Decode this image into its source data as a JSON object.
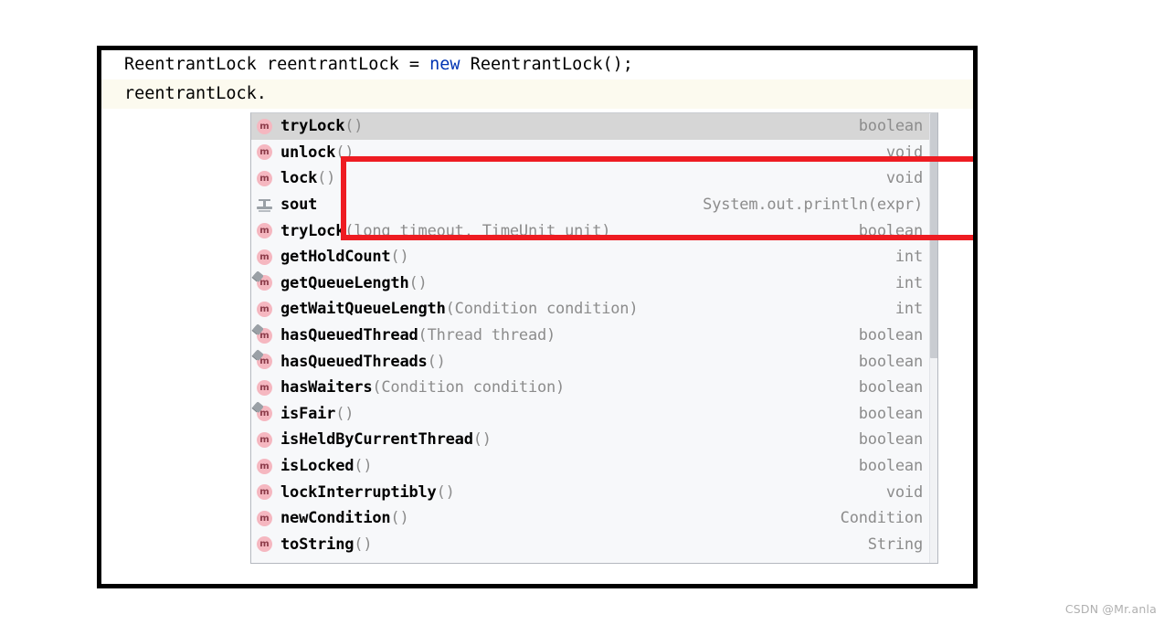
{
  "editor": {
    "lines": [
      {
        "id": "line-1",
        "segments": [
          {
            "text": "ReentrantLock reentrantLock = ",
            "kind": "plain"
          },
          {
            "text": "new",
            "kind": "keyword"
          },
          {
            "text": " ReentrantLock();",
            "kind": "plain"
          }
        ],
        "highlighted": false
      },
      {
        "id": "line-2",
        "segments": [
          {
            "text": "reentrantLock.",
            "kind": "plain"
          }
        ],
        "highlighted": true
      }
    ],
    "line1_prefix": "ReentrantLock reentrantLock = ",
    "line1_keyword": "new",
    "line1_suffix": " ReentrantLock();",
    "line2_text": "reentrantLock."
  },
  "completion": {
    "selected_index": 0,
    "items": [
      {
        "icon": "method-icon",
        "name": "tryLock",
        "params": "()",
        "type": "boolean"
      },
      {
        "icon": "method-icon",
        "name": "unlock",
        "params": "()",
        "type": "void"
      },
      {
        "icon": "method-icon",
        "name": "lock",
        "params": "()",
        "type": "void"
      },
      {
        "icon": "template-icon",
        "name": "sout",
        "params": "",
        "type": "System.out.println(expr)"
      },
      {
        "icon": "method-icon",
        "name": "tryLock",
        "params": "(long timeout, TimeUnit unit)",
        "type": "boolean"
      },
      {
        "icon": "method-icon",
        "name": "getHoldCount",
        "params": "()",
        "type": "int"
      },
      {
        "icon": "method-final-icon",
        "name": "getQueueLength",
        "params": "()",
        "type": "int"
      },
      {
        "icon": "method-icon",
        "name": "getWaitQueueLength",
        "params": "(Condition condition)",
        "type": "int"
      },
      {
        "icon": "method-final-icon",
        "name": "hasQueuedThread",
        "params": "(Thread thread)",
        "type": "boolean"
      },
      {
        "icon": "method-final-icon",
        "name": "hasQueuedThreads",
        "params": "()",
        "type": "boolean"
      },
      {
        "icon": "method-icon",
        "name": "hasWaiters",
        "params": "(Condition condition)",
        "type": "boolean"
      },
      {
        "icon": "method-final-icon",
        "name": "isFair",
        "params": "()",
        "type": "boolean"
      },
      {
        "icon": "method-icon",
        "name": "isHeldByCurrentThread",
        "params": "()",
        "type": "boolean"
      },
      {
        "icon": "method-icon",
        "name": "isLocked",
        "params": "()",
        "type": "boolean"
      },
      {
        "icon": "method-icon",
        "name": "lockInterruptibly",
        "params": "()",
        "type": "void"
      },
      {
        "icon": "method-icon",
        "name": "newCondition",
        "params": "()",
        "type": "Condition"
      },
      {
        "icon": "method-icon",
        "name": "toString",
        "params": "()",
        "type": "String"
      }
    ]
  },
  "annotation": {
    "highlight_color": "#ee1c22",
    "highlight_label": "red-rectangle-around-first-three-suggestions"
  },
  "watermark": {
    "text": "CSDN @Mr.anla"
  },
  "colors": {
    "keyword": "#0033b3",
    "caret_line_bg": "#fcfaef",
    "popup_bg": "#f7f8fa",
    "selected_row_bg": "#d6d6d6",
    "muted_text": "#8c8c8c",
    "method_icon_bg": "#f5b7c0",
    "frame_border": "#000000"
  }
}
